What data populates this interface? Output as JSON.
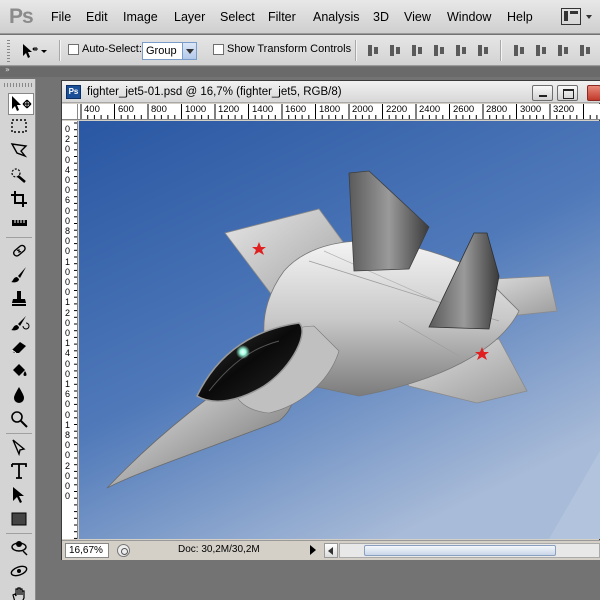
{
  "app": {
    "logo": "Ps"
  },
  "menu": [
    "File",
    "Edit",
    "Image",
    "Layer",
    "Select",
    "Filter",
    "Analysis",
    "3D",
    "View",
    "Window",
    "Help"
  ],
  "options": {
    "auto_select_label": "Auto-Select:",
    "auto_select_value": "Group",
    "transform_label": "Show Transform Controls"
  },
  "toolbox": {
    "collapse_glyph": "»",
    "tools": [
      "move-tool",
      "rectangular-marquee-tool",
      "lasso-tool",
      "quick-selection-tool",
      "crop-tool",
      "eyedropper-tool",
      "spot-healing-brush-tool",
      "brush-tool",
      "clone-stamp-tool",
      "history-brush-tool",
      "eraser-tool",
      "paint-bucket-tool",
      "blur-tool",
      "dodge-tool",
      "path-selection-tool",
      "type-tool",
      "pen-tool",
      "rectangle-tool",
      "3d-rotate-tool",
      "3d-orbit-tool",
      "hand-tool"
    ]
  },
  "document": {
    "ps_icon": "Ps",
    "title": "fighter_jet5-01.psd @ 16,7% (fighter_jet5, RGB/8)",
    "ruler_h": [
      "400",
      "600",
      "800",
      "1000",
      "1200",
      "1400",
      "1600",
      "1800",
      "2000",
      "2200",
      "2400",
      "2600",
      "2800",
      "3000",
      "3200"
    ],
    "ruler_v": [
      "0",
      "2",
      "0",
      "0",
      "4",
      "0",
      "0",
      "6",
      "0",
      "0",
      "8",
      "0",
      "0",
      "1",
      "0",
      "0",
      "0",
      "1",
      "2",
      "0",
      "0",
      "1",
      "4",
      "0",
      "0",
      "1",
      "6",
      "0",
      "0",
      "1",
      "8",
      "0",
      "0",
      "2",
      "0",
      "0",
      "0"
    ]
  },
  "status": {
    "zoom": "16,67%",
    "doc_info": "Doc: 30,2M/30,2M"
  },
  "colors": {
    "sky_top": "#2b5aa6",
    "sky_bottom": "#a9bcd9",
    "star": "#e02020"
  }
}
